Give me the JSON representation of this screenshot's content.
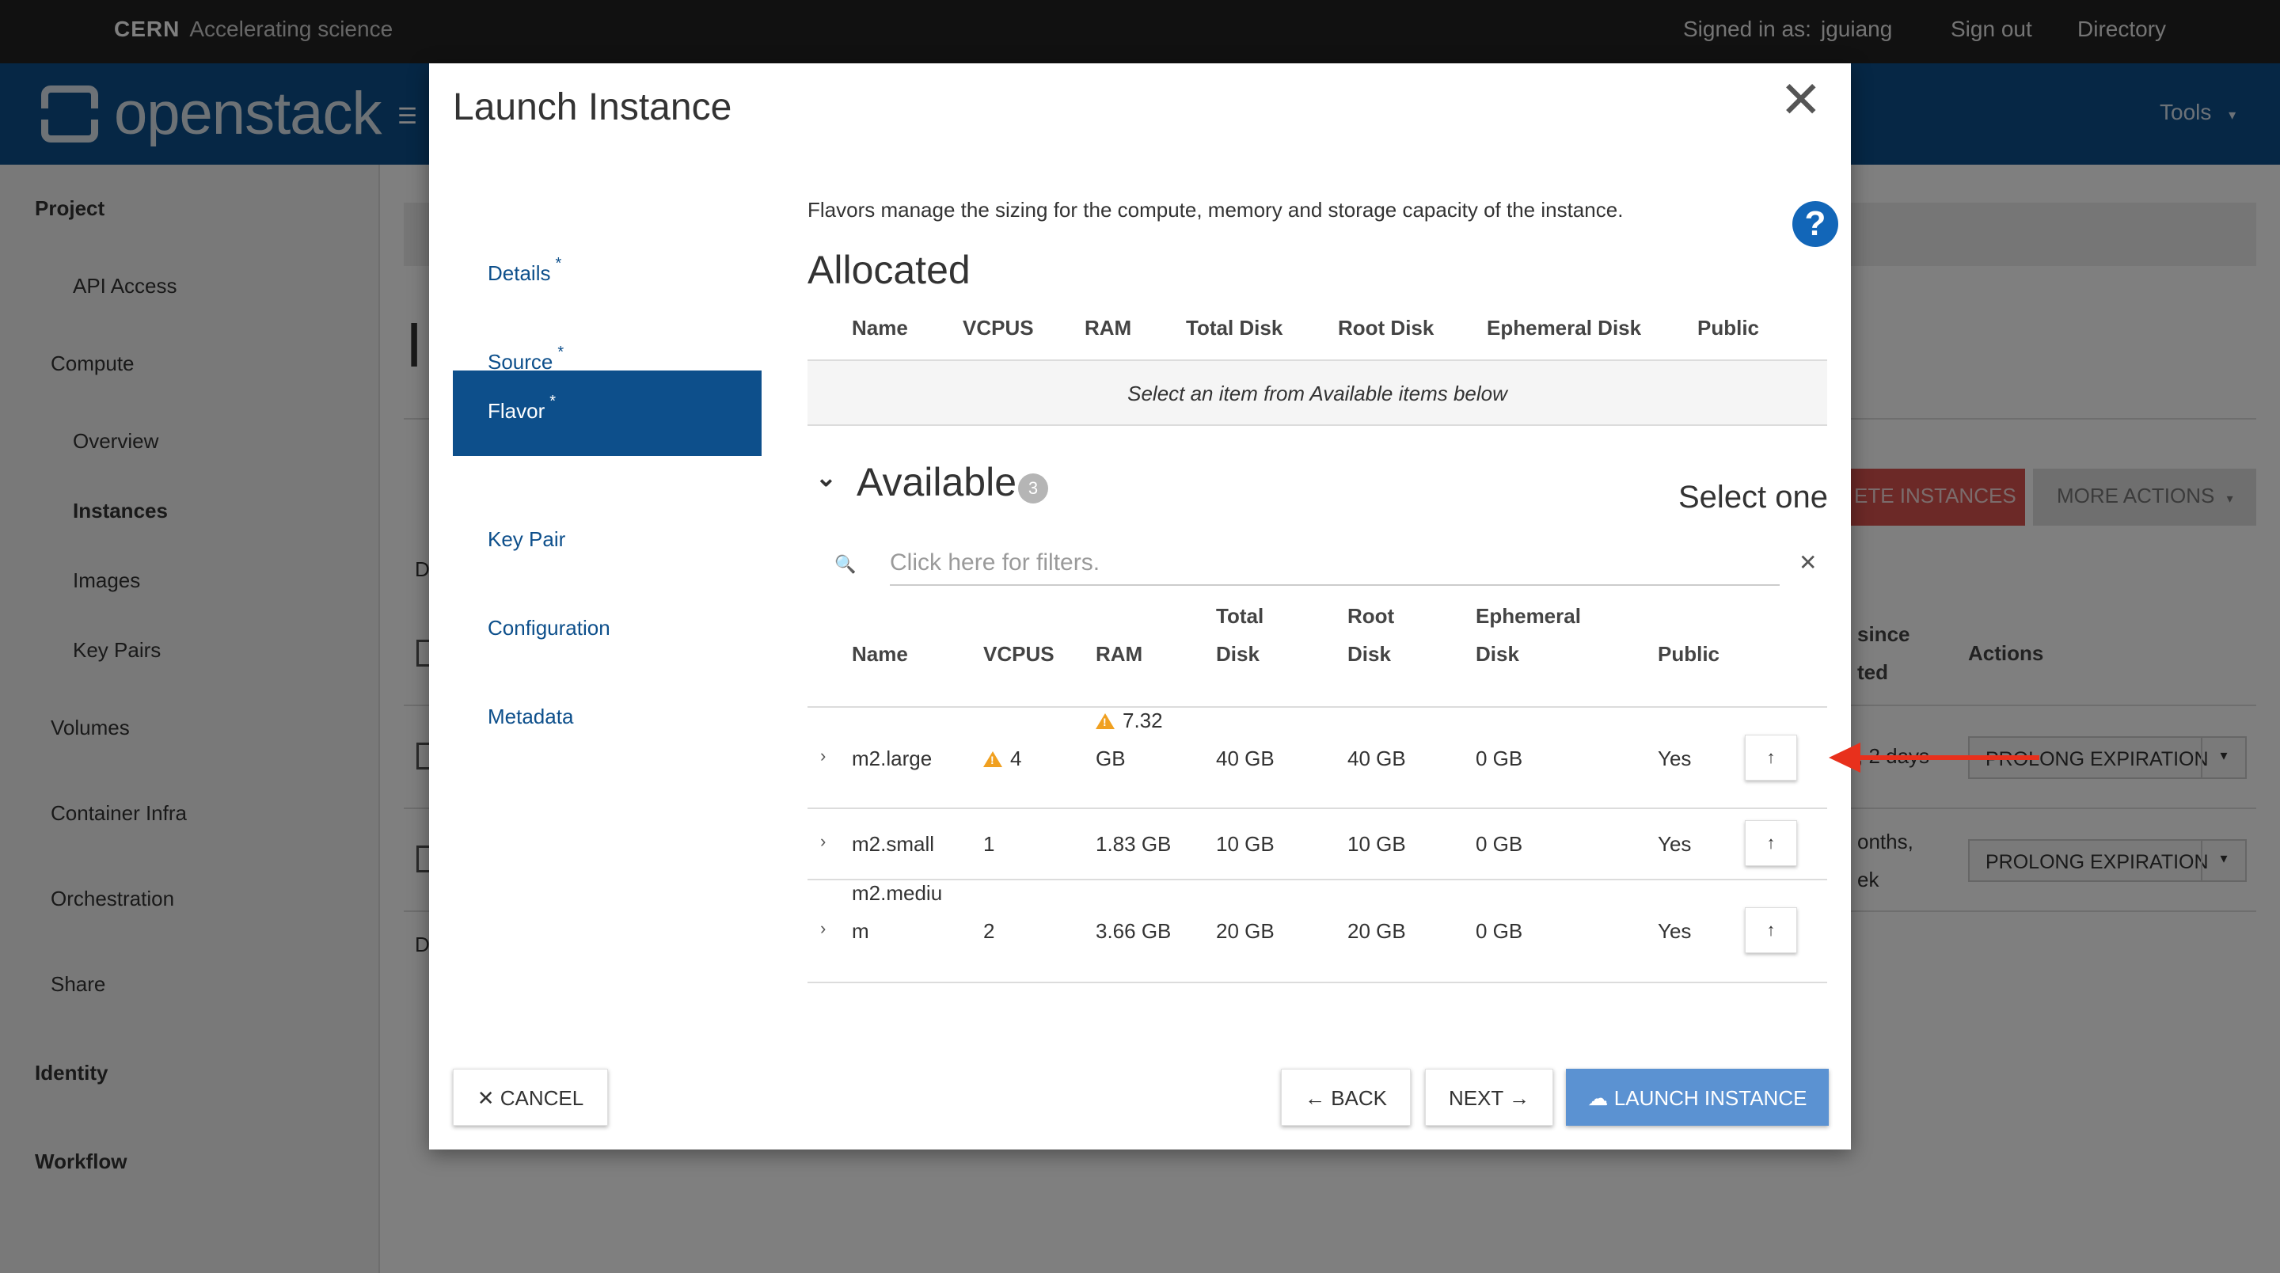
{
  "cern": {
    "brand_bold": "CERN",
    "brand_tagline": "Accelerating science",
    "signed_in_label": "Signed in as:",
    "username": "jguiang",
    "sign_out": "Sign out",
    "directory": "Directory"
  },
  "header": {
    "logo_text": "openstack",
    "tools": "Tools"
  },
  "sidebar": {
    "items": [
      {
        "label": "Project"
      },
      {
        "label": "API Access"
      },
      {
        "label": "Compute"
      },
      {
        "label": "Overview"
      },
      {
        "label": "Instances"
      },
      {
        "label": "Images"
      },
      {
        "label": "Key Pairs"
      },
      {
        "label": "Volumes"
      },
      {
        "label": "Container Infra"
      },
      {
        "label": "Orchestration"
      },
      {
        "label": "Share"
      },
      {
        "label": "Identity"
      },
      {
        "label": "Workflow"
      }
    ]
  },
  "background": {
    "page_letter": "I",
    "delete_btn": "ETE INSTANCES",
    "more_actions": "MORE ACTIONS",
    "col_since_1": "since",
    "col_since_2": "ted",
    "col_actions": "Actions",
    "row1_time": ", 2 days",
    "row2_time_1": "onths,",
    "row2_time_2": "ek",
    "prolong": "PROLONG EXPIRATION",
    "d1": "D",
    "d2": "D"
  },
  "modal": {
    "title": "Launch Instance",
    "close": "✕",
    "steps": [
      {
        "label": "Details",
        "required": "*"
      },
      {
        "label": "Source",
        "required": "*"
      },
      {
        "label": "Flavor",
        "required": "*"
      },
      {
        "label": "Key Pair",
        "required": ""
      },
      {
        "label": "Configuration",
        "required": ""
      },
      {
        "label": "Metadata",
        "required": ""
      }
    ],
    "active_step": "Flavor",
    "help_text": "Flavors manage the sizing for the compute, memory and storage capacity of the instance.",
    "help_icon": "?",
    "allocated": {
      "title": "Allocated",
      "columns": [
        "Name",
        "VCPUS",
        "RAM",
        "Total Disk",
        "Root Disk",
        "Ephemeral Disk",
        "Public"
      ],
      "empty_text": "Select an item from Available items below"
    },
    "available": {
      "title": "Available",
      "count": "3",
      "select_one": "Select one",
      "filter_placeholder": "Click here for filters.",
      "columns": {
        "name": "Name",
        "vcpus": "VCPUS",
        "ram": "RAM",
        "total_disk_1": "Total",
        "total_disk_2": "Disk",
        "root_disk_1": "Root",
        "root_disk_2": "Disk",
        "eph_disk_1": "Ephemeral",
        "eph_disk_2": "Disk",
        "public": "Public"
      },
      "rows": [
        {
          "name_1": "m2.large",
          "name_2": "",
          "vcpus": "4",
          "vcpus_warning": true,
          "ram_1": "7.32",
          "ram_2": "GB",
          "ram_warning": true,
          "total_disk": "40 GB",
          "root_disk": "40 GB",
          "eph_disk": "0 GB",
          "public": "Yes"
        },
        {
          "name_1": "m2.small",
          "name_2": "",
          "vcpus": "1",
          "vcpus_warning": false,
          "ram_1": "1.83 GB",
          "ram_2": "",
          "ram_warning": false,
          "total_disk": "10 GB",
          "root_disk": "10 GB",
          "eph_disk": "0 GB",
          "public": "Yes"
        },
        {
          "name_1": "m2.mediu",
          "name_2": "m",
          "vcpus": "2",
          "vcpus_warning": false,
          "ram_1": "3.66 GB",
          "ram_2": "",
          "ram_warning": false,
          "total_disk": "20 GB",
          "root_disk": "20 GB",
          "eph_disk": "0 GB",
          "public": "Yes"
        }
      ]
    },
    "footer": {
      "cancel": "✕ CANCEL",
      "back": "← BACK",
      "next": "NEXT →",
      "launch": "☁ LAUNCH INSTANCE"
    }
  },
  "colors": {
    "brand_blue": "#0d4f8b",
    "primary_button": "#5b92d2",
    "warning": "#f0a020",
    "annotation_arrow": "#e8301c",
    "danger": "#d9534f"
  }
}
